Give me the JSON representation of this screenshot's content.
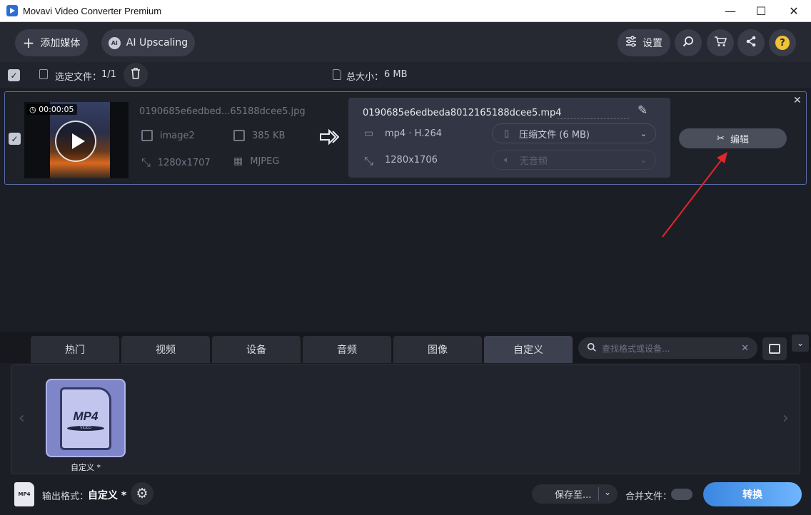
{
  "window": {
    "title": "Movavi Video Converter Premium"
  },
  "toolbar": {
    "add_media": "添加媒体",
    "ai_upscaling": "AI Upscaling",
    "settings": "设置"
  },
  "selection": {
    "selected_label": "选定文件：",
    "selected_value": "1/1",
    "total_label": "总大小：",
    "total_value": "6 MB"
  },
  "file": {
    "duration": "00:00:05",
    "source_name": "0190685e6edbed...65188dcee5.jpg",
    "source_format": "image2",
    "source_size": "385 KB",
    "source_resolution": "1280x1707",
    "source_codec": "MJPEG",
    "output_name": "0190685e6edbeda8012165188dcee5.mp4",
    "output_format": "mp4 · H.264",
    "output_resolution": "1280x1706",
    "compress_label": "压缩文件 (6 MB)",
    "audio_label": "无音频",
    "edit_label": "编辑"
  },
  "tabs": [
    "热门",
    "视频",
    "设备",
    "音频",
    "图像",
    "自定义"
  ],
  "search": {
    "placeholder": "查找格式或设备..."
  },
  "format_card": {
    "badge": "MP4",
    "sub": "VIDEO",
    "label": "自定义 *"
  },
  "footer": {
    "output_format_label": "输出格式：",
    "output_format_value": "自定义 *",
    "save_to": "保存至...",
    "merge_label": "合并文件：",
    "convert_label": "转换"
  },
  "colors": {
    "accent": "#7e85c8",
    "background": "#1c1e26",
    "annotation_arrow": "#e3262a"
  }
}
